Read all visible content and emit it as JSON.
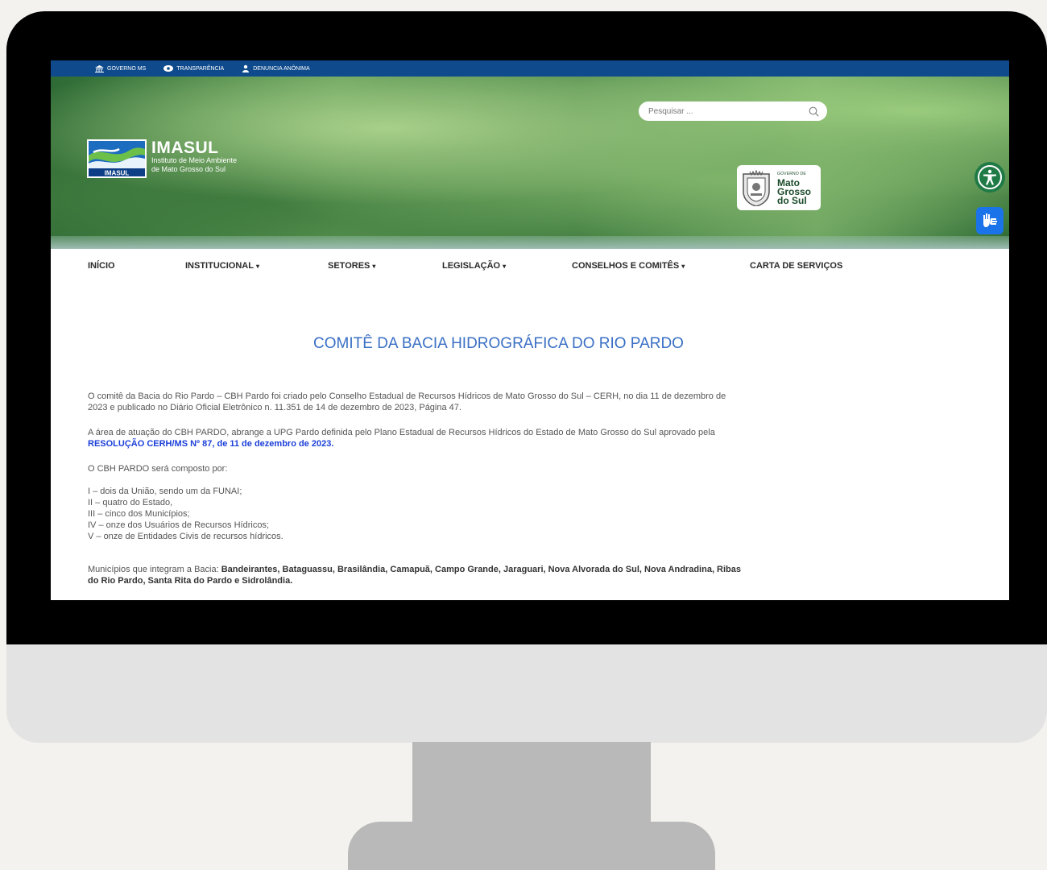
{
  "topbar": {
    "items": [
      {
        "label": "GOVERNO MS",
        "icon": "building-icon"
      },
      {
        "label": "TRANSPARÊNCIA",
        "icon": "eye-icon"
      },
      {
        "label": "DENUNCIA ANÔNIMA",
        "icon": "user-secret-icon"
      }
    ]
  },
  "search": {
    "placeholder": "Pesquisar ..."
  },
  "logo": {
    "badge": "IMASUL",
    "title": "IMASUL",
    "subtitle_line1": "Instituto de Meio Ambiente",
    "subtitle_line2": "de Mato Grosso do Sul"
  },
  "gov_logo": {
    "small": "GOVERNO DE",
    "line1": "Mato",
    "line2": "Grosso",
    "line3": "do Sul"
  },
  "nav": {
    "items": [
      {
        "label": "INÍCIO",
        "dropdown": false
      },
      {
        "label": "INSTITUCIONAL",
        "dropdown": true
      },
      {
        "label": "SETORES",
        "dropdown": true
      },
      {
        "label": "LEGISLAÇÃO",
        "dropdown": true
      },
      {
        "label": "CONSELHOS E COMITÊS",
        "dropdown": true
      },
      {
        "label": "CARTA DE SERVIÇOS",
        "dropdown": false
      }
    ]
  },
  "content": {
    "title": "COMITÊ DA BACIA HIDROGRÁFICA DO RIO PARDO",
    "p1_line1": "O comitê da Bacia do Rio Pardo – CBH Pardo foi criado pelo Conselho Estadual de Recursos Hídricos de Mato Grosso do Sul – CERH, no dia 11 de dezembro de",
    "p1_line2": "2023 e publicado no Diário Oficial Eletrônico n. 11.351 de 14 de dezembro de 2023, Página 47.",
    "p2_line1": "A área de atuação do CBH PARDO, abrange a UPG Pardo definida pelo Plano Estadual de Recursos Hídricos do Estado de Mato Grosso do Sul aprovado pela",
    "p2_link": "RESOLUÇÃO CERH/MS Nº 87, de 11 de dezembro de 2023.",
    "p3": "O CBH PARDO será composto por:",
    "list": [
      "I – dois da União, sendo um da FUNAI;",
      "II – quatro do Estado,",
      "III – cinco dos Municípios;",
      "IV – onze dos Usuários de Recursos Hídricos;",
      "V – onze de Entidades Civis de recursos hídricos."
    ],
    "p4_prefix": "Municípios que integram a Bacia: ",
    "p4_bold_line1": "Bandeirantes, Bataguassu, Brasilândia, Camapuã, Campo Grande, Jaraguari, Nova Alvorada do Sul, Nova Andradina, Ribas",
    "p4_bold_line2": "do Rio Pardo, Santa Rita do Pardo e Sidrolândia."
  },
  "colors": {
    "topbar": "#0e4a8c",
    "title": "#3a6fc4",
    "link": "#1b3fd9",
    "accessibility": "#1f7a46",
    "libras": "#1a73e8"
  }
}
